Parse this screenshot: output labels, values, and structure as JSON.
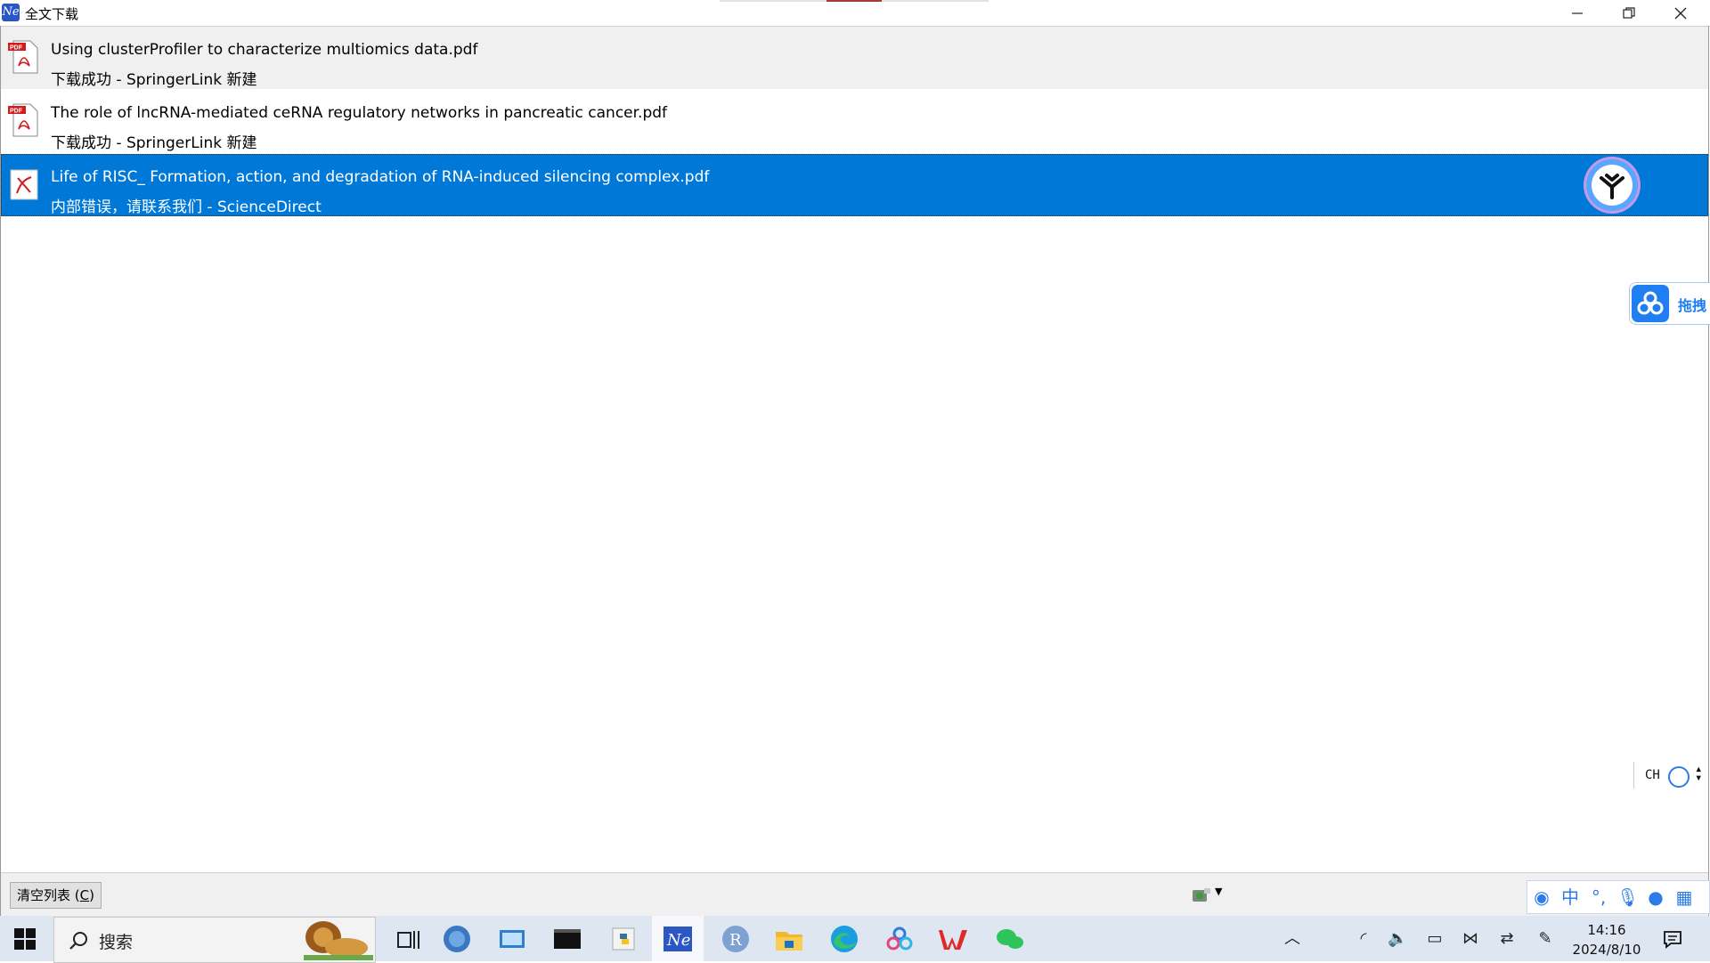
{
  "window": {
    "title": "全文下载",
    "app_icon_glyph": "Ne",
    "minimize_icon": "minimize-icon",
    "maximize_icon": "restore-icon",
    "close_icon": "close-icon"
  },
  "downloads": [
    {
      "title": "Using clusterProfiler to characterize multiomics data.pdf",
      "status": "下载成功  -  SpringerLink 新建",
      "icon": "pdf-icon",
      "state": "success"
    },
    {
      "title": "The role of lncRNA-mediated ceRNA regulatory networks in pancreatic cancer.pdf",
      "status": "下载成功  -  SpringerLink 新建",
      "icon": "pdf-icon",
      "state": "success"
    },
    {
      "title": "Life of RISC_ Formation, action, and degradation of RNA-induced silencing complex.pdf",
      "status": "内部错误，请联系我们  -  ScienceDirect",
      "icon": "pdf-error-icon",
      "state": "error",
      "selected": true
    }
  ],
  "floating": {
    "baidu_drag_label": "拖拽",
    "ime_label": "CH"
  },
  "statusbar": {
    "clear_button_label": "清空列表 (",
    "clear_button_key": "C",
    "clear_button_tail": ")"
  },
  "taskbar": {
    "search_placeholder": "搜索",
    "time": "14:16",
    "date": "2024/8/10",
    "ime_chinese": "中"
  },
  "colors": {
    "selection": "#0078d7",
    "accent": "#2d7be5",
    "taskbar": "#dee6f2"
  }
}
